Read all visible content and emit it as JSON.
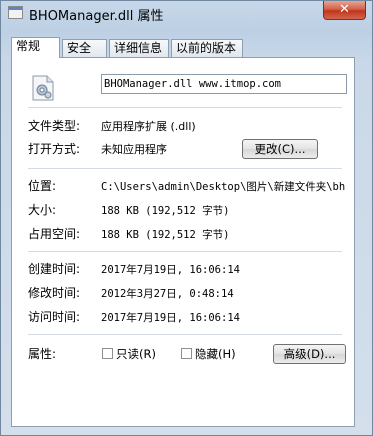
{
  "window": {
    "title": "BHOManager.dll 属性",
    "close_label": "✕"
  },
  "tabs": [
    {
      "label": "常规",
      "active": true
    },
    {
      "label": "安全",
      "active": false
    },
    {
      "label": "详细信息",
      "active": false
    },
    {
      "label": "以前的版本",
      "active": false
    }
  ],
  "general": {
    "file_name": "BHOManager.dll www.itmop.com",
    "rows": {
      "file_type": {
        "label": "文件类型:",
        "value": "应用程序扩展 (.dll)"
      },
      "open_with": {
        "label": "打开方式:",
        "value": "未知应用程序",
        "button": "更改(C)..."
      },
      "location": {
        "label": "位置:",
        "value": "C:\\Users\\admin\\Desktop\\图片\\新建文件夹\\bh"
      },
      "size": {
        "label": "大小:",
        "value": "188 KB (192,512 字节)"
      },
      "size_on_disk": {
        "label": "占用空间:",
        "value": "188 KB (192,512 字节)"
      },
      "created": {
        "label": "创建时间:",
        "value": "2017年7月19日, 16:06:14"
      },
      "modified": {
        "label": "修改时间:",
        "value": "2012年3月27日, 0:48:14"
      },
      "accessed": {
        "label": "访问时间:",
        "value": "2017年7月19日, 16:06:14"
      },
      "attributes": {
        "label": "属性:",
        "readonly_label": "只读(R)",
        "readonly_checked": false,
        "hidden_label": "隐藏(H)",
        "hidden_checked": false,
        "advanced_button": "高级(D)..."
      }
    }
  }
}
